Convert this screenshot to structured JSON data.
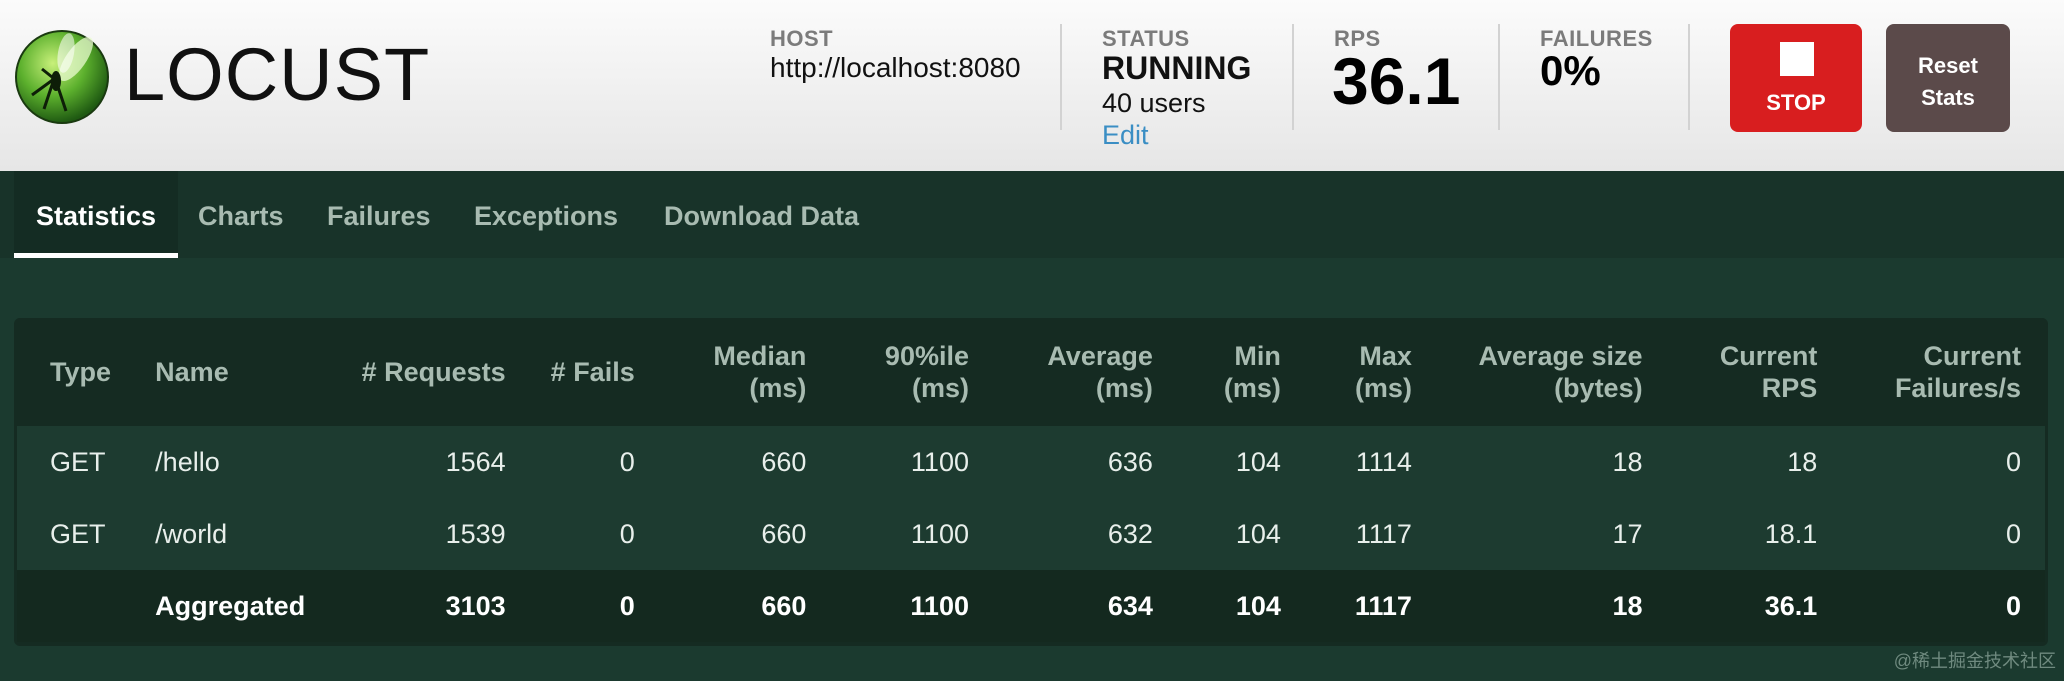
{
  "logo": {
    "text": "LOCUST"
  },
  "host": {
    "label": "HOST",
    "value": "http://localhost:8080"
  },
  "status": {
    "label": "STATUS",
    "value": "RUNNING",
    "users": "40 users",
    "edit": "Edit"
  },
  "rps": {
    "label": "RPS",
    "value": "36.1"
  },
  "failures": {
    "label": "FAILURES",
    "value": "0%"
  },
  "buttons": {
    "stop": "STOP",
    "reset_line1": "Reset",
    "reset_line2": "Stats"
  },
  "tabs": [
    {
      "label": "Statistics",
      "active": true
    },
    {
      "label": "Charts"
    },
    {
      "label": "Failures"
    },
    {
      "label": "Exceptions"
    },
    {
      "label": "Download Data"
    }
  ],
  "table": {
    "headers": [
      [
        "Type"
      ],
      [
        "Name"
      ],
      [
        "# Requests"
      ],
      [
        "# Fails"
      ],
      [
        "Median",
        "(ms)"
      ],
      [
        "90%ile",
        "(ms)"
      ],
      [
        "Average",
        "(ms)"
      ],
      [
        "Min",
        "(ms)"
      ],
      [
        "Max",
        "(ms)"
      ],
      [
        "Average size",
        "(bytes)"
      ],
      [
        "Current",
        "RPS"
      ],
      [
        "Current",
        "Failures/s"
      ]
    ],
    "rows": [
      [
        "GET",
        "/hello",
        "1564",
        "0",
        "660",
        "1100",
        "636",
        "104",
        "1114",
        "18",
        "18",
        "0"
      ],
      [
        "GET",
        "/world",
        "1539",
        "0",
        "660",
        "1100",
        "632",
        "104",
        "1117",
        "17",
        "18.1",
        "0"
      ]
    ],
    "aggregated": [
      "",
      "Aggregated",
      "3103",
      "0",
      "660",
      "1100",
      "634",
      "104",
      "1117",
      "18",
      "36.1",
      "0"
    ]
  },
  "watermark": "@稀土掘金技术社区",
  "colors": {
    "header_bg": "#f2f2f2",
    "page_bg": "#1b3a2f",
    "stop": "#d81e1f",
    "reset": "#5b4a4a",
    "edit_link": "#3a8ec4"
  }
}
